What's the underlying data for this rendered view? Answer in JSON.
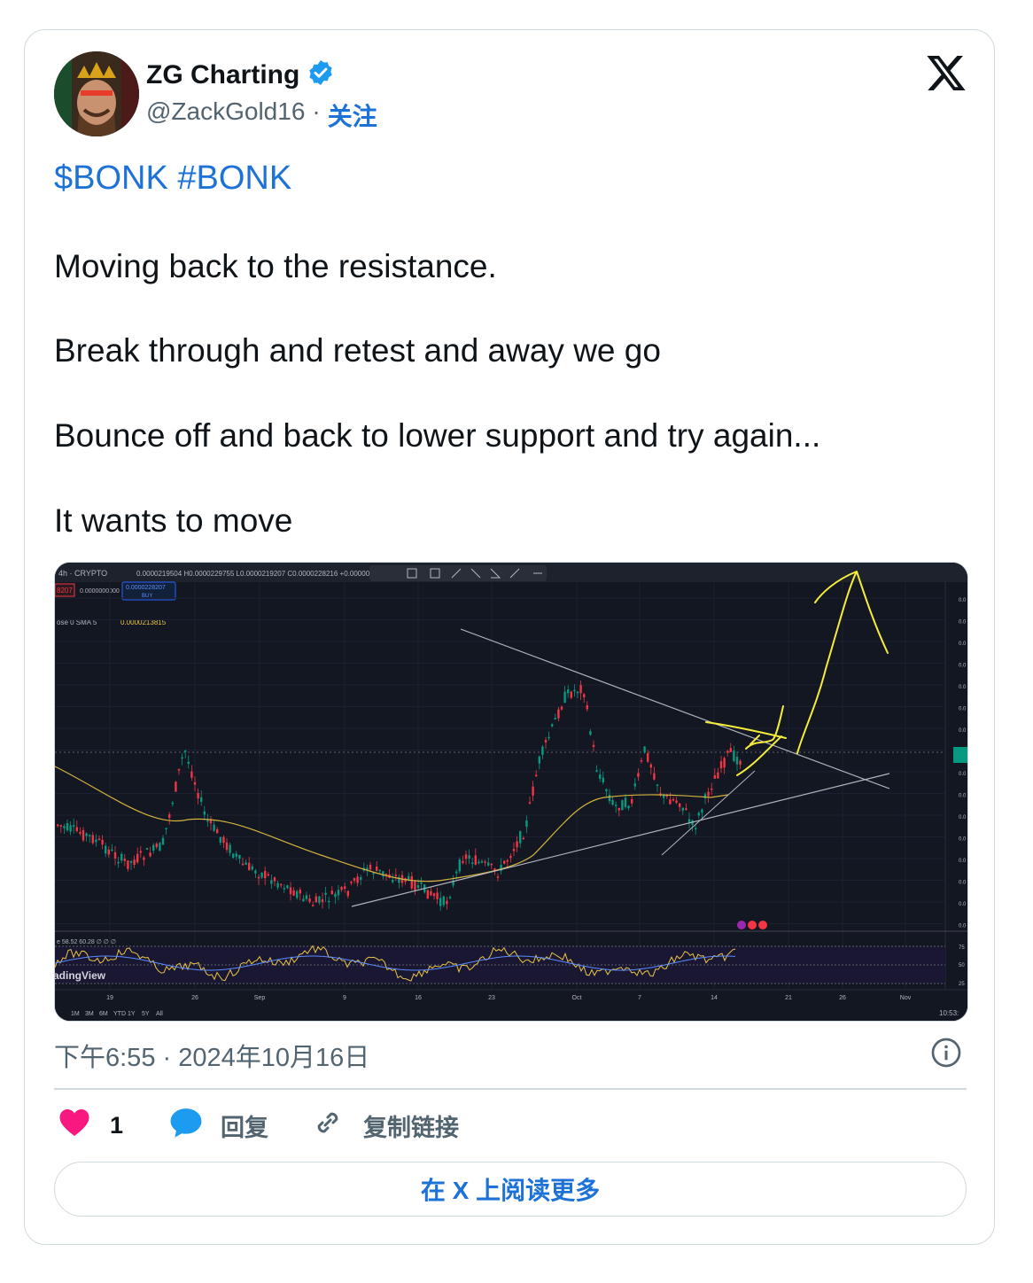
{
  "author": {
    "name": "ZG Charting",
    "handle": "@ZackGold16",
    "separator": "·",
    "follow_label": "关注",
    "verified": true
  },
  "tweet": {
    "tags": "$BONK #BONK",
    "paragraphs": [
      "Moving back to the resistance.",
      "Break through and retest and away we go",
      "Bounce off and back to lower support and try again...",
      "It wants to move"
    ],
    "timestamp": "下午6:55 · 2024年10月16日"
  },
  "actions": {
    "like_count": "1",
    "reply_label": "回复",
    "copy_link_label": "复制链接"
  },
  "read_more_label": "在 X 上阅读更多",
  "chart_image": {
    "symbol_label": "4h · CRYPTO",
    "ohlc_text": "0.0000219504 H0.0000229755 L0.0000219207 C0.0000228216 +0.00000",
    "sell_price": "8207",
    "mid_value": "0.0000000000",
    "buy_price": "0.0000228207",
    "buy_label": "BUY",
    "sma_label": "ose 0 SMA 5",
    "sma_value": "0.0000213815",
    "rsi_label": "e 58.52 60.28 ∅ ∅ ∅",
    "watermark": "adingView",
    "x_ticks": [
      "19",
      "26",
      "Sep",
      "9",
      "16",
      "23",
      "Oct",
      "7",
      "14",
      "21",
      "26",
      "Nov"
    ],
    "rsi_ticks": [
      "75",
      "50",
      "25"
    ],
    "timeframes": [
      "1M",
      "3M",
      "6M",
      "YTD",
      "1Y",
      "5Y",
      "All"
    ],
    "clock": "10:53:"
  },
  "colors": {
    "link_blue": "#1d72d8",
    "like_red": "#f91880",
    "reply_blue": "#1d9bf0",
    "chart_bg": "#131722",
    "annotation_yellow": "#f5ec3b"
  }
}
